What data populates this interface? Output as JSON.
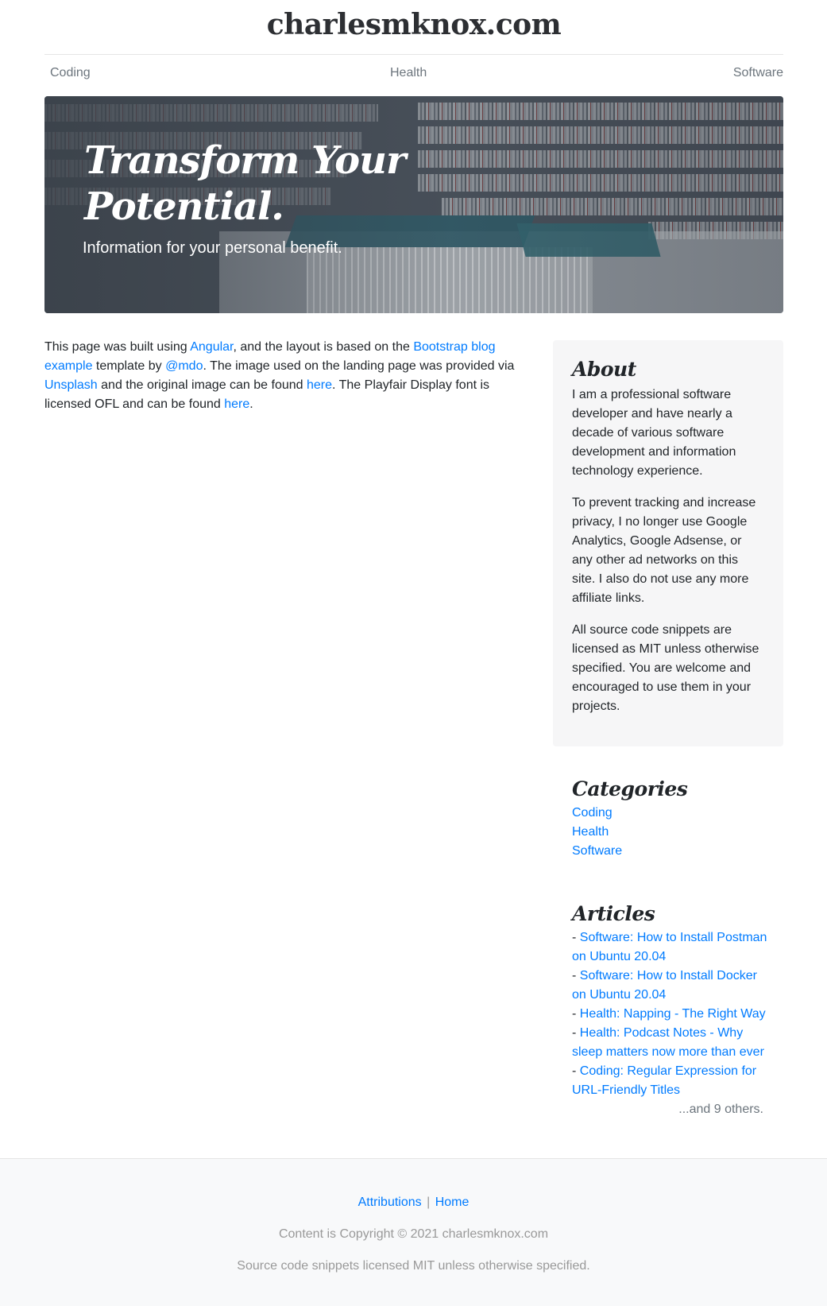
{
  "header": {
    "site_title": "charlesmknox.com"
  },
  "nav": {
    "items": [
      {
        "label": "Coding"
      },
      {
        "label": "Health"
      },
      {
        "label": "Software"
      }
    ]
  },
  "hero": {
    "title": "Transform Your Potential.",
    "lead": "Information for your personal benefit."
  },
  "main": {
    "intro": {
      "t1": "This page was built using ",
      "l1": "Angular",
      "t2": ", and the layout is based on the ",
      "l2": "Bootstrap blog example",
      "t3": " template by ",
      "l3": "@mdo",
      "t4": ". The image used on the landing page was provided via ",
      "l4": "Unsplash",
      "t5": " and the original image can be found ",
      "l5": "here",
      "t6": ". The Playfair Display font is licensed OFL and can be found ",
      "l6": "here",
      "t7": "."
    }
  },
  "sidebar": {
    "about": {
      "heading": "About",
      "paragraphs": [
        "I am a professional software developer and have nearly a decade of various software development and information technology experience.",
        "To prevent tracking and increase privacy, I no longer use Google Analytics, Google Adsense, or any other ad networks on this site. I also do not use any more affiliate links.",
        "All source code snippets are licensed as MIT unless otherwise specified. You are welcome and encouraged to use them in your projects."
      ]
    },
    "categories": {
      "heading": "Categories",
      "items": [
        "Coding",
        "Health",
        "Software"
      ]
    },
    "articles": {
      "heading": "Articles",
      "bullet": "- ",
      "items": [
        "Software: How to Install Postman on Ubuntu 20.04",
        "Software: How to Install Docker on Ubuntu 20.04",
        "Health: Napping - The Right Way",
        "Health: Podcast Notes - Why sleep matters now more than ever",
        "Coding: Regular Expression for URL-Friendly Titles"
      ],
      "more": "...and 9 others."
    }
  },
  "footer": {
    "attributions": "Attributions",
    "separator": "|",
    "home": "Home",
    "copyright": "Content is Copyright © 2021 charlesmknox.com",
    "license": "Source code snippets licensed MIT unless otherwise specified."
  },
  "colors": {
    "link": "#007bff",
    "muted": "#6c757d",
    "sidebar_bg": "#f6f6f7",
    "footer_bg": "#f8f9fa"
  }
}
